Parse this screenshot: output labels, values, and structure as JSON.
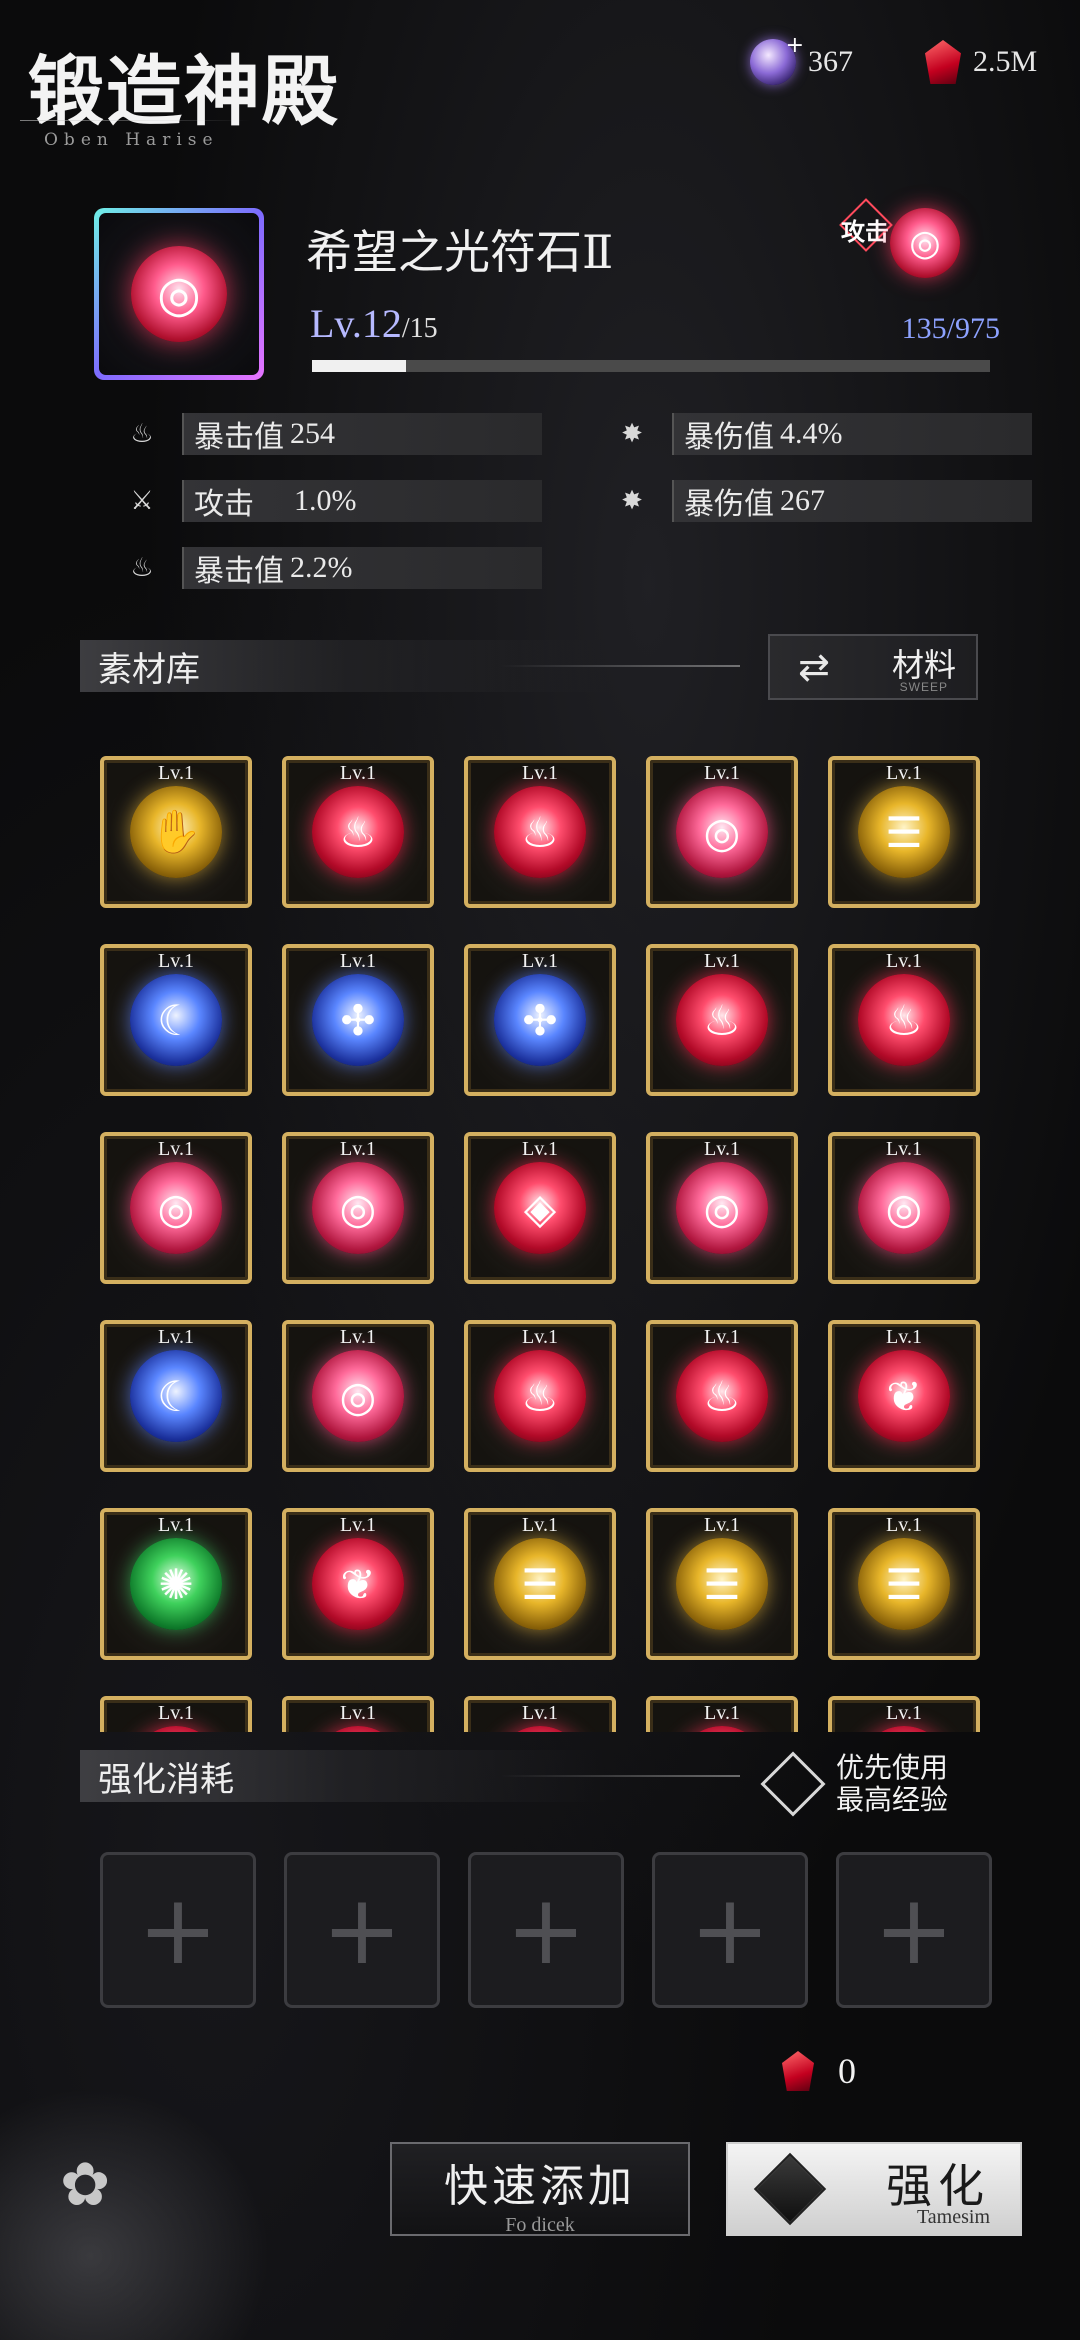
{
  "header": {
    "title": "锻造神殿",
    "subtitle": "Oben Harise"
  },
  "currencies": [
    {
      "icon": "crystal-gem-icon",
      "value": "367"
    },
    {
      "icon": "red-ruby-icon",
      "value": "2.5M"
    }
  ],
  "item": {
    "name": "希望之光符石Ⅱ",
    "level": "Lv.12",
    "level_max": "/15",
    "exp": "135/975",
    "exp_fraction": 0.1385,
    "type_tag": "攻击",
    "icon": "crescent-rune-icon"
  },
  "stats": [
    {
      "icon": "flame-icon",
      "label": "暴击值",
      "value": "254"
    },
    {
      "icon": "sword-icon",
      "label": "攻击",
      "value": "1.0%"
    },
    {
      "icon": "flame-icon",
      "label": "暴击值",
      "value": "2.2%"
    },
    {
      "icon": "burst-icon",
      "label": "暴伤值",
      "value": "4.4%"
    },
    {
      "icon": "burst-icon",
      "label": "暴伤值",
      "value": "267"
    }
  ],
  "materials": {
    "title": "素材库",
    "sort_label": "材料",
    "sort_sub": "SWEEP",
    "level_label": "Lv.1",
    "items": [
      {
        "color": "gold",
        "glyph": "✋",
        "icon": "gauntlet-rune-icon"
      },
      {
        "color": "red",
        "glyph": "♨",
        "icon": "flame-rune-icon"
      },
      {
        "color": "red",
        "glyph": "♨",
        "icon": "flame-rune-icon"
      },
      {
        "color": "pink",
        "glyph": "◎",
        "icon": "crescent-rune-icon"
      },
      {
        "color": "gold",
        "glyph": "☰",
        "icon": "claw-rune-icon"
      },
      {
        "color": "blue",
        "glyph": "☾",
        "icon": "moon-rune-icon"
      },
      {
        "color": "blue",
        "glyph": "✣",
        "icon": "frost-rune-icon"
      },
      {
        "color": "blue",
        "glyph": "✣",
        "icon": "frost-rune-icon"
      },
      {
        "color": "red",
        "glyph": "♨",
        "icon": "flame-rune-icon"
      },
      {
        "color": "red",
        "glyph": "♨",
        "icon": "flame-rune-icon"
      },
      {
        "color": "pink",
        "glyph": "◎",
        "icon": "crescent-rune-icon"
      },
      {
        "color": "pink",
        "glyph": "◎",
        "icon": "crescent-rune-icon"
      },
      {
        "color": "red",
        "glyph": "◈",
        "icon": "diamond-rune-icon"
      },
      {
        "color": "pink",
        "glyph": "◎",
        "icon": "crescent-rune-icon"
      },
      {
        "color": "pink",
        "glyph": "◎",
        "icon": "crescent-rune-icon"
      },
      {
        "color": "blue",
        "glyph": "☾",
        "icon": "moon-rune-icon"
      },
      {
        "color": "pink",
        "glyph": "◎",
        "icon": "crescent-rune-icon"
      },
      {
        "color": "red",
        "glyph": "♨",
        "icon": "flame-rune-icon"
      },
      {
        "color": "red",
        "glyph": "♨",
        "icon": "flame-rune-icon"
      },
      {
        "color": "red",
        "glyph": "❦",
        "icon": "tree-rune-icon"
      },
      {
        "color": "green",
        "glyph": "✺",
        "icon": "swirl-rune-icon"
      },
      {
        "color": "red",
        "glyph": "❦",
        "icon": "tree-rune-icon"
      },
      {
        "color": "gold",
        "glyph": "☰",
        "icon": "claw-rune-icon"
      },
      {
        "color": "gold",
        "glyph": "☰",
        "icon": "claw-rune-icon"
      },
      {
        "color": "gold",
        "glyph": "☰",
        "icon": "claw-rune-icon"
      },
      {
        "color": "red",
        "glyph": "♨",
        "icon": "flame-rune-icon"
      },
      {
        "color": "red",
        "glyph": "♨",
        "icon": "flame-rune-icon"
      },
      {
        "color": "red",
        "glyph": "♨",
        "icon": "flame-rune-icon"
      },
      {
        "color": "red",
        "glyph": "♨",
        "icon": "flame-rune-icon"
      },
      {
        "color": "red",
        "glyph": "♨",
        "icon": "flame-rune-icon"
      }
    ]
  },
  "enhance": {
    "title": "强化消耗",
    "priority_line1": "优先使用",
    "priority_line2": "最高经验",
    "slots": 5,
    "cost_value": "0",
    "quick_add_label": "快速添加",
    "quick_add_sub": "Fo dicek",
    "enhance_label": "强化",
    "enhance_sub": "Tamesim"
  }
}
